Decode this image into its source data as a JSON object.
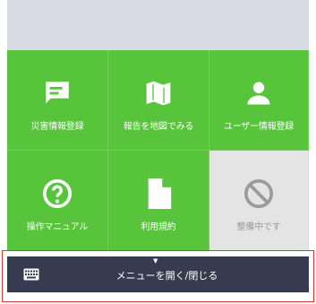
{
  "tiles": [
    {
      "label": "災害情報登録",
      "icon": "chat-icon",
      "enabled": true
    },
    {
      "label": "報告を地図でみる",
      "icon": "map-icon",
      "enabled": true
    },
    {
      "label": "ユーザー情報登録",
      "icon": "person-icon",
      "enabled": true
    },
    {
      "label": "操作マニュアル",
      "icon": "help-icon",
      "enabled": true
    },
    {
      "label": "利用規約",
      "icon": "document-icon",
      "enabled": true
    },
    {
      "label": "整備中です",
      "icon": "prohibited-icon",
      "enabled": false
    }
  ],
  "menu_bar": {
    "label": "メニューを開く/閉じる",
    "icon": "keyboard-icon",
    "caret_icon": "caret-down-icon"
  },
  "colors": {
    "tile_green": "#58c43c",
    "disabled_tile": "#e4e4e4",
    "menu_bar": "#373b50",
    "highlight_frame": "#d63a3a"
  }
}
